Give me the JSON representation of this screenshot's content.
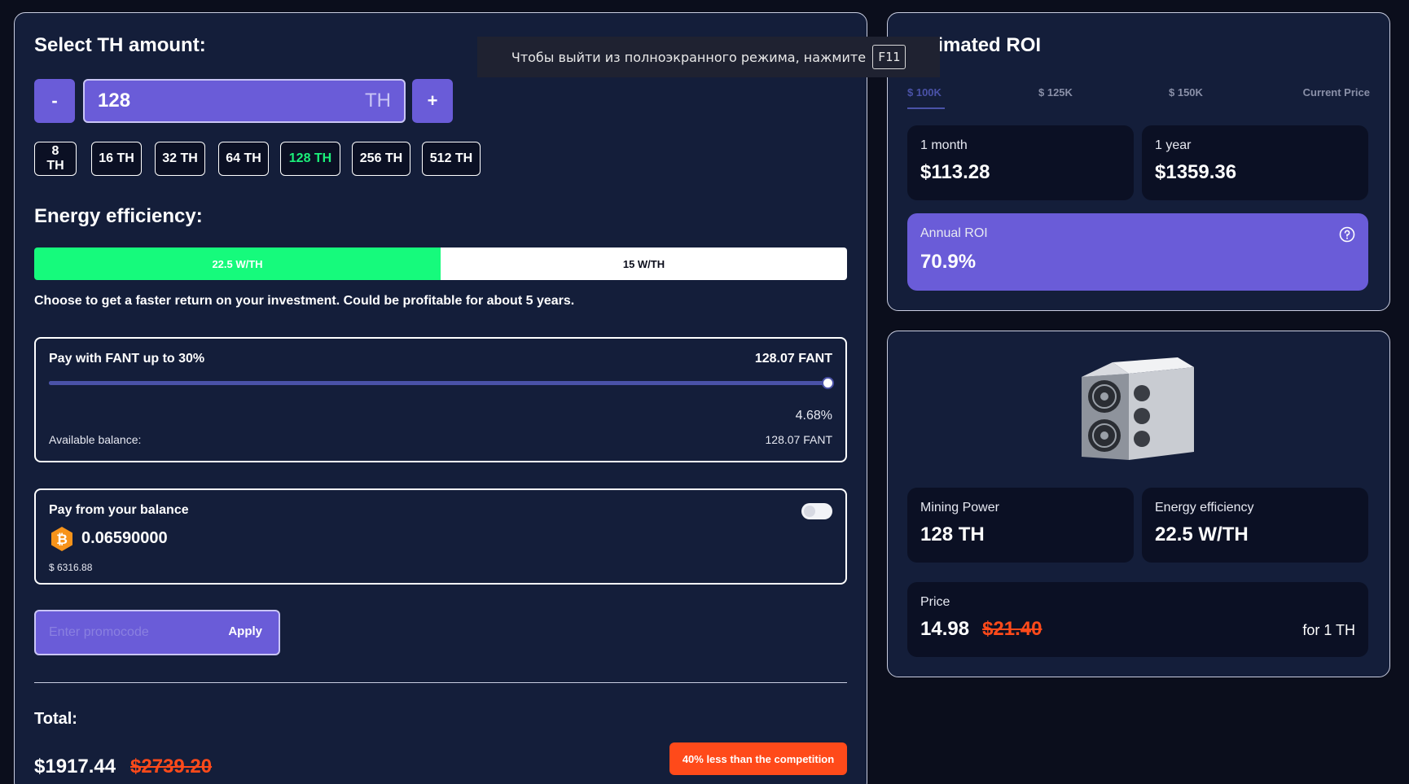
{
  "th": {
    "title": "Select TH amount:",
    "minus": "-",
    "plus": "+",
    "value": "128",
    "unit": "TH",
    "presets": [
      "8 TH",
      "16 TH",
      "32 TH",
      "64 TH",
      "128 TH",
      "256 TH",
      "512 TH"
    ],
    "active_preset": "128 TH"
  },
  "efficiency": {
    "title": "Energy efficiency:",
    "options": [
      "22.5 W/TH",
      "15 W/TH"
    ],
    "selected": "22.5 W/TH",
    "description": "Choose to get a faster return on your investment. Could be profitable for about 5 years."
  },
  "fant": {
    "label": "Pay with FANT up to 30%",
    "amount": "128.07 FANT",
    "slider_fraction": 1.0,
    "percent": "4.68%",
    "balance_label": "Available balance:",
    "balance_value": "128.07 FANT"
  },
  "balance": {
    "label": "Pay from your balance",
    "btc_amount": "0.06590000",
    "usd_amount": "$ 6316.88",
    "toggle_on": false
  },
  "promo": {
    "placeholder": "Enter promocode",
    "apply": "Apply"
  },
  "total": {
    "label": "Total:",
    "price": "$1917.44",
    "old_price": "$2739.20",
    "badge": "40% less than the competition"
  },
  "roi": {
    "title": "Estimated ROI",
    "tabs": [
      "$ 100K",
      "$ 125K",
      "$ 150K",
      "Current Price"
    ],
    "active_tab": "$ 100K",
    "month_label": "1 month",
    "month_value": "$113.28",
    "year_label": "1 year",
    "year_value": "$1359.36",
    "annual_label": "Annual ROI",
    "annual_value": "70.9%"
  },
  "product": {
    "power_label": "Mining Power",
    "power_value": "128 TH",
    "eff_label": "Energy efficiency",
    "eff_value": "22.5 W/TH",
    "price_label": "Price",
    "price": "14.98",
    "old_price": "$21.40",
    "per_unit": "for 1 TH"
  },
  "toast": {
    "text": "Чтобы выйти из полноэкранного режима, нажмите",
    "key": "F11"
  },
  "colors": {
    "accent": "#6a5cd8",
    "green": "#16fa7c",
    "red": "#ff4a1a",
    "bitcoin": "#f7931a"
  }
}
